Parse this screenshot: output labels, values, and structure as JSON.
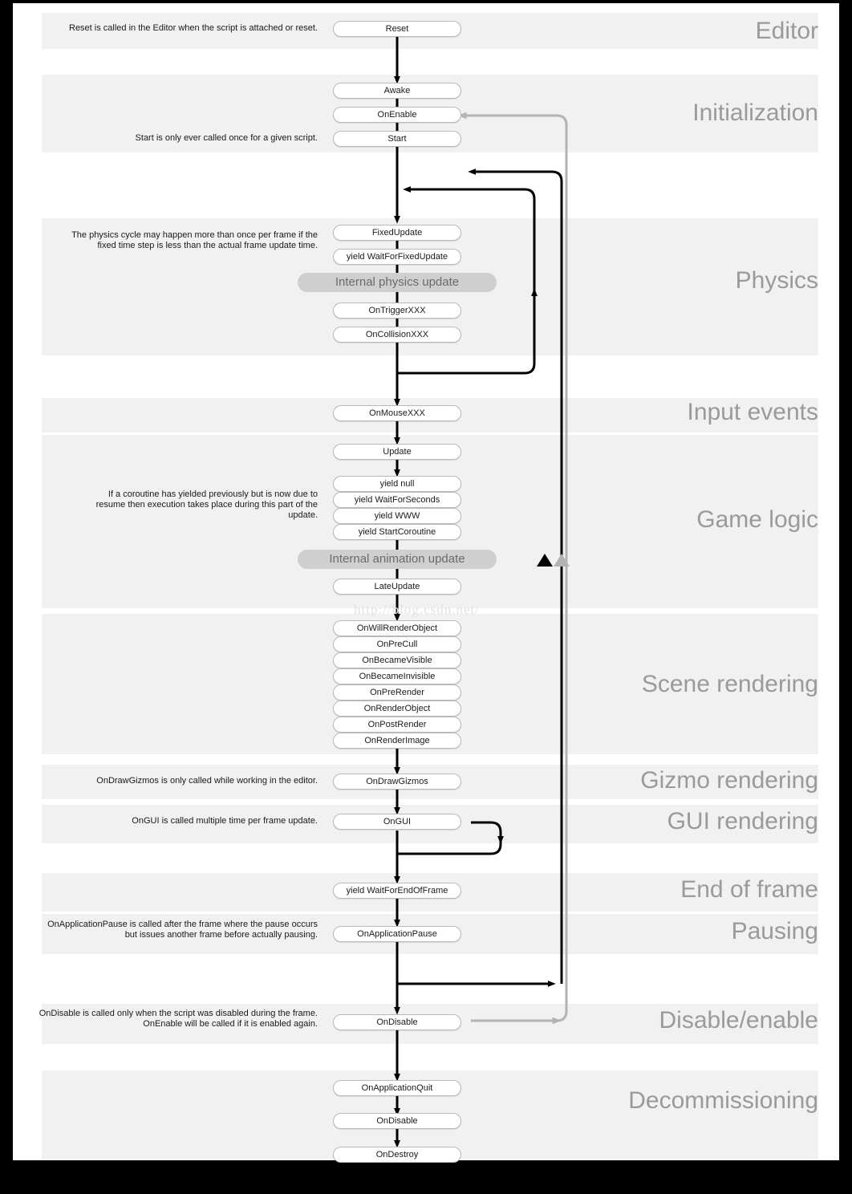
{
  "diagram": {
    "title": "Unity MonoBehaviour Script Lifecycle Flowchart",
    "watermark": "http://blog.csdn.net/",
    "colors": {
      "band": "#f1f1f1",
      "page": "#ffffff",
      "border": "#000000",
      "node_fill": "#ffffff",
      "node_stroke": "#b9b9b9",
      "internal_fill": "#cfcfcf",
      "internal_text": "#6a6a6a",
      "band_label": "#9a9a9a",
      "flow_black": "#000000",
      "flow_gray": "#b3b3b3",
      "watermark": "#e2e2e2"
    },
    "sections": [
      {
        "label": "Editor"
      },
      {
        "label": "Initialization"
      },
      {
        "label": "Physics"
      },
      {
        "label": "Input events"
      },
      {
        "label": "Game logic"
      },
      {
        "label": "Scene rendering"
      },
      {
        "label": "Gizmo rendering"
      },
      {
        "label": "GUI rendering"
      },
      {
        "label": "End of frame"
      },
      {
        "label": "Pausing"
      },
      {
        "label": "Disable/enable"
      },
      {
        "label": "Decommissioning"
      }
    ],
    "nodes": [
      {
        "label": "Reset"
      },
      {
        "label": "Awake"
      },
      {
        "label": "OnEnable"
      },
      {
        "label": "Start"
      },
      {
        "label": "FixedUpdate"
      },
      {
        "label": "yield WaitForFixedUpdate"
      },
      {
        "label": "OnTriggerXXX"
      },
      {
        "label": "OnCollisionXXX"
      },
      {
        "label": "OnMouseXXX"
      },
      {
        "label": "Update"
      },
      {
        "label": "yield null"
      },
      {
        "label": "yield WaitForSeconds"
      },
      {
        "label": "yield WWW"
      },
      {
        "label": "yield StartCoroutine"
      },
      {
        "label": "LateUpdate"
      },
      {
        "label": "OnWillRenderObject"
      },
      {
        "label": "OnPreCull"
      },
      {
        "label": "OnBecameVisible"
      },
      {
        "label": "OnBecameInvisible"
      },
      {
        "label": "OnPreRender"
      },
      {
        "label": "OnRenderObject"
      },
      {
        "label": "OnPostRender"
      },
      {
        "label": "OnRenderImage"
      },
      {
        "label": "OnDrawGizmos"
      },
      {
        "label": "OnGUI"
      },
      {
        "label": "yield WaitForEndOfFrame"
      },
      {
        "label": "OnApplicationPause"
      },
      {
        "label": "OnDisable"
      },
      {
        "label": "OnApplicationQuit"
      },
      {
        "label": "OnDisable"
      },
      {
        "label": "OnDestroy"
      }
    ],
    "internal_steps": [
      {
        "label": "Internal physics update"
      },
      {
        "label": "Internal animation update"
      }
    ],
    "notes": [
      {
        "text": "Reset is called in the Editor when the script is attached or reset."
      },
      {
        "text": "Start is only ever called once for a given script."
      },
      {
        "text": "The physics cycle may happen more than once per frame if the fixed time step is less than the actual frame update time."
      },
      {
        "text": "If a coroutine has yielded previously but is now due to resume then execution takes place during this part of the update."
      },
      {
        "text": "OnDrawGizmos is only called while working in the editor."
      },
      {
        "text": "OnGUI is called multiple time per frame update."
      },
      {
        "text": "OnApplicationPause is called after the frame where the pause occurs but issues another frame before actually pausing."
      },
      {
        "text": "OnDisable is called only when the script was disabled during the frame. OnEnable will be called if it is enabled again."
      }
    ]
  }
}
